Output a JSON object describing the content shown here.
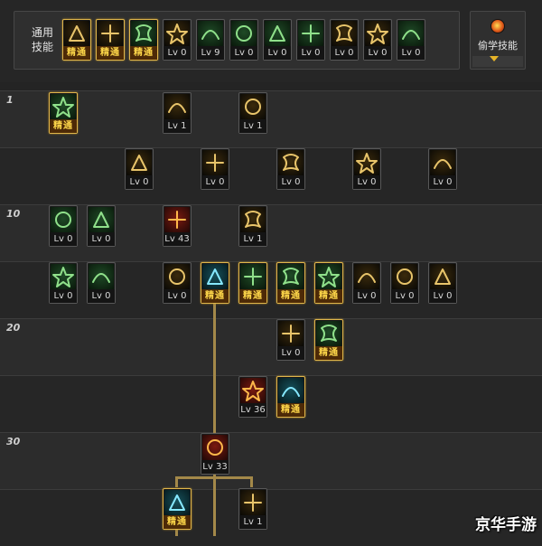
{
  "general": {
    "label_line1": "通用",
    "label_line2": "技能",
    "skills": [
      {
        "icon": "sitting-figure-icon",
        "caption": "精通",
        "master": true,
        "art": "gold"
      },
      {
        "icon": "crouching-figure-icon",
        "caption": "精通",
        "master": true,
        "art": "gold"
      },
      {
        "icon": "dashing-figure-icon",
        "caption": "精通",
        "master": true,
        "art": "green"
      },
      {
        "icon": "winged-emblem-icon",
        "caption": "Lv 0",
        "master": false,
        "art": "gold"
      },
      {
        "icon": "target-icon",
        "caption": "Lv 9",
        "master": false,
        "art": "green"
      },
      {
        "icon": "gear-target-icon",
        "caption": "Lv 0",
        "master": false,
        "art": "green"
      },
      {
        "icon": "runner-icon",
        "caption": "Lv 0",
        "master": false,
        "art": "green"
      },
      {
        "icon": "climber-icon",
        "caption": "Lv 0",
        "master": false,
        "art": "green"
      },
      {
        "icon": "eye-icon",
        "caption": "Lv 0",
        "master": false,
        "art": "gold"
      },
      {
        "icon": "strongman-icon",
        "caption": "Lv 0",
        "master": false,
        "art": "gold"
      },
      {
        "icon": "plant-icon",
        "caption": "Lv 0",
        "master": false,
        "art": "green"
      }
    ]
  },
  "steal": {
    "label": "偷学技能",
    "icon": "fire-orb-icon",
    "arrow": "chevron-down-icon",
    "accent": "#e6b428"
  },
  "levels": [
    "1",
    "10",
    "20",
    "30"
  ],
  "tree": [
    {
      "icon": "bottom-stance-icon",
      "caption": "精通",
      "master": true,
      "art": "green"
    },
    {
      "icon": "claw-slash-icon",
      "caption": "Lv 1",
      "master": false,
      "art": "gold"
    },
    {
      "icon": "sweep-slash-icon",
      "caption": "Lv 1",
      "master": false,
      "art": "gold"
    },
    {
      "icon": "feather-burst-icon",
      "caption": "Lv 0",
      "master": false,
      "art": "gold"
    },
    {
      "icon": "arrow-strike-icon",
      "caption": "Lv 0",
      "master": false,
      "art": "gold"
    },
    {
      "icon": "spiral-wind-icon",
      "caption": "Lv 0",
      "master": false,
      "art": "gold"
    },
    {
      "icon": "cross-shield-icon",
      "caption": "Lv 0",
      "master": false,
      "art": "gold"
    },
    {
      "icon": "triple-fang-icon",
      "caption": "Lv 0",
      "master": false,
      "art": "gold"
    },
    {
      "icon": "green-arrow-icon",
      "caption": "Lv 0",
      "master": false,
      "art": "green"
    },
    {
      "icon": "green-blade-icon",
      "caption": "Lv 0",
      "master": false,
      "art": "green"
    },
    {
      "icon": "flame-burst-icon",
      "caption": "Lv 43",
      "master": false,
      "art": "red"
    },
    {
      "icon": "cyclone-icon",
      "caption": "Lv 1",
      "master": false,
      "art": "gold"
    },
    {
      "icon": "green-slash-icon",
      "caption": "Lv 0",
      "master": false,
      "art": "green"
    },
    {
      "icon": "spiky-orb-icon",
      "caption": "Lv 0",
      "master": false,
      "art": "green"
    },
    {
      "icon": "sword-star-icon",
      "caption": "Lv 0",
      "master": false,
      "art": "gold"
    },
    {
      "icon": "energy-orb-icon",
      "caption": "精通",
      "master": true,
      "art": "teal"
    },
    {
      "icon": "ring-burst-icon",
      "caption": "精通",
      "master": true,
      "art": "green"
    },
    {
      "icon": "flexing-figure-icon",
      "caption": "精通",
      "master": true,
      "art": "green"
    },
    {
      "icon": "holy-cross-icon",
      "caption": "精通",
      "master": true,
      "art": "green"
    },
    {
      "icon": "whirl-slash-icon",
      "caption": "Lv 0",
      "master": false,
      "art": "gold"
    },
    {
      "icon": "crescent-icon",
      "caption": "Lv 0",
      "master": false,
      "art": "gold"
    },
    {
      "icon": "rising-flame-icon",
      "caption": "Lv 0",
      "master": false,
      "art": "gold"
    },
    {
      "icon": "heart-shield-icon",
      "caption": "Lv 0",
      "master": false,
      "art": "gold"
    },
    {
      "icon": "double-claw-icon",
      "caption": "精通",
      "master": true,
      "art": "green"
    },
    {
      "icon": "blood-strike-icon",
      "caption": "Lv 36",
      "master": false,
      "art": "red"
    },
    {
      "icon": "water-spirit-icon",
      "caption": "精通",
      "master": true,
      "art": "teal"
    },
    {
      "icon": "starburst-icon",
      "caption": "Lv 33",
      "master": false,
      "art": "red"
    },
    {
      "icon": "ice-shard-icon",
      "caption": "精通",
      "master": true,
      "art": "teal"
    },
    {
      "icon": "horn-blast-icon",
      "caption": "Lv 1",
      "master": false,
      "art": "gold"
    }
  ],
  "watermark": "京华手游"
}
